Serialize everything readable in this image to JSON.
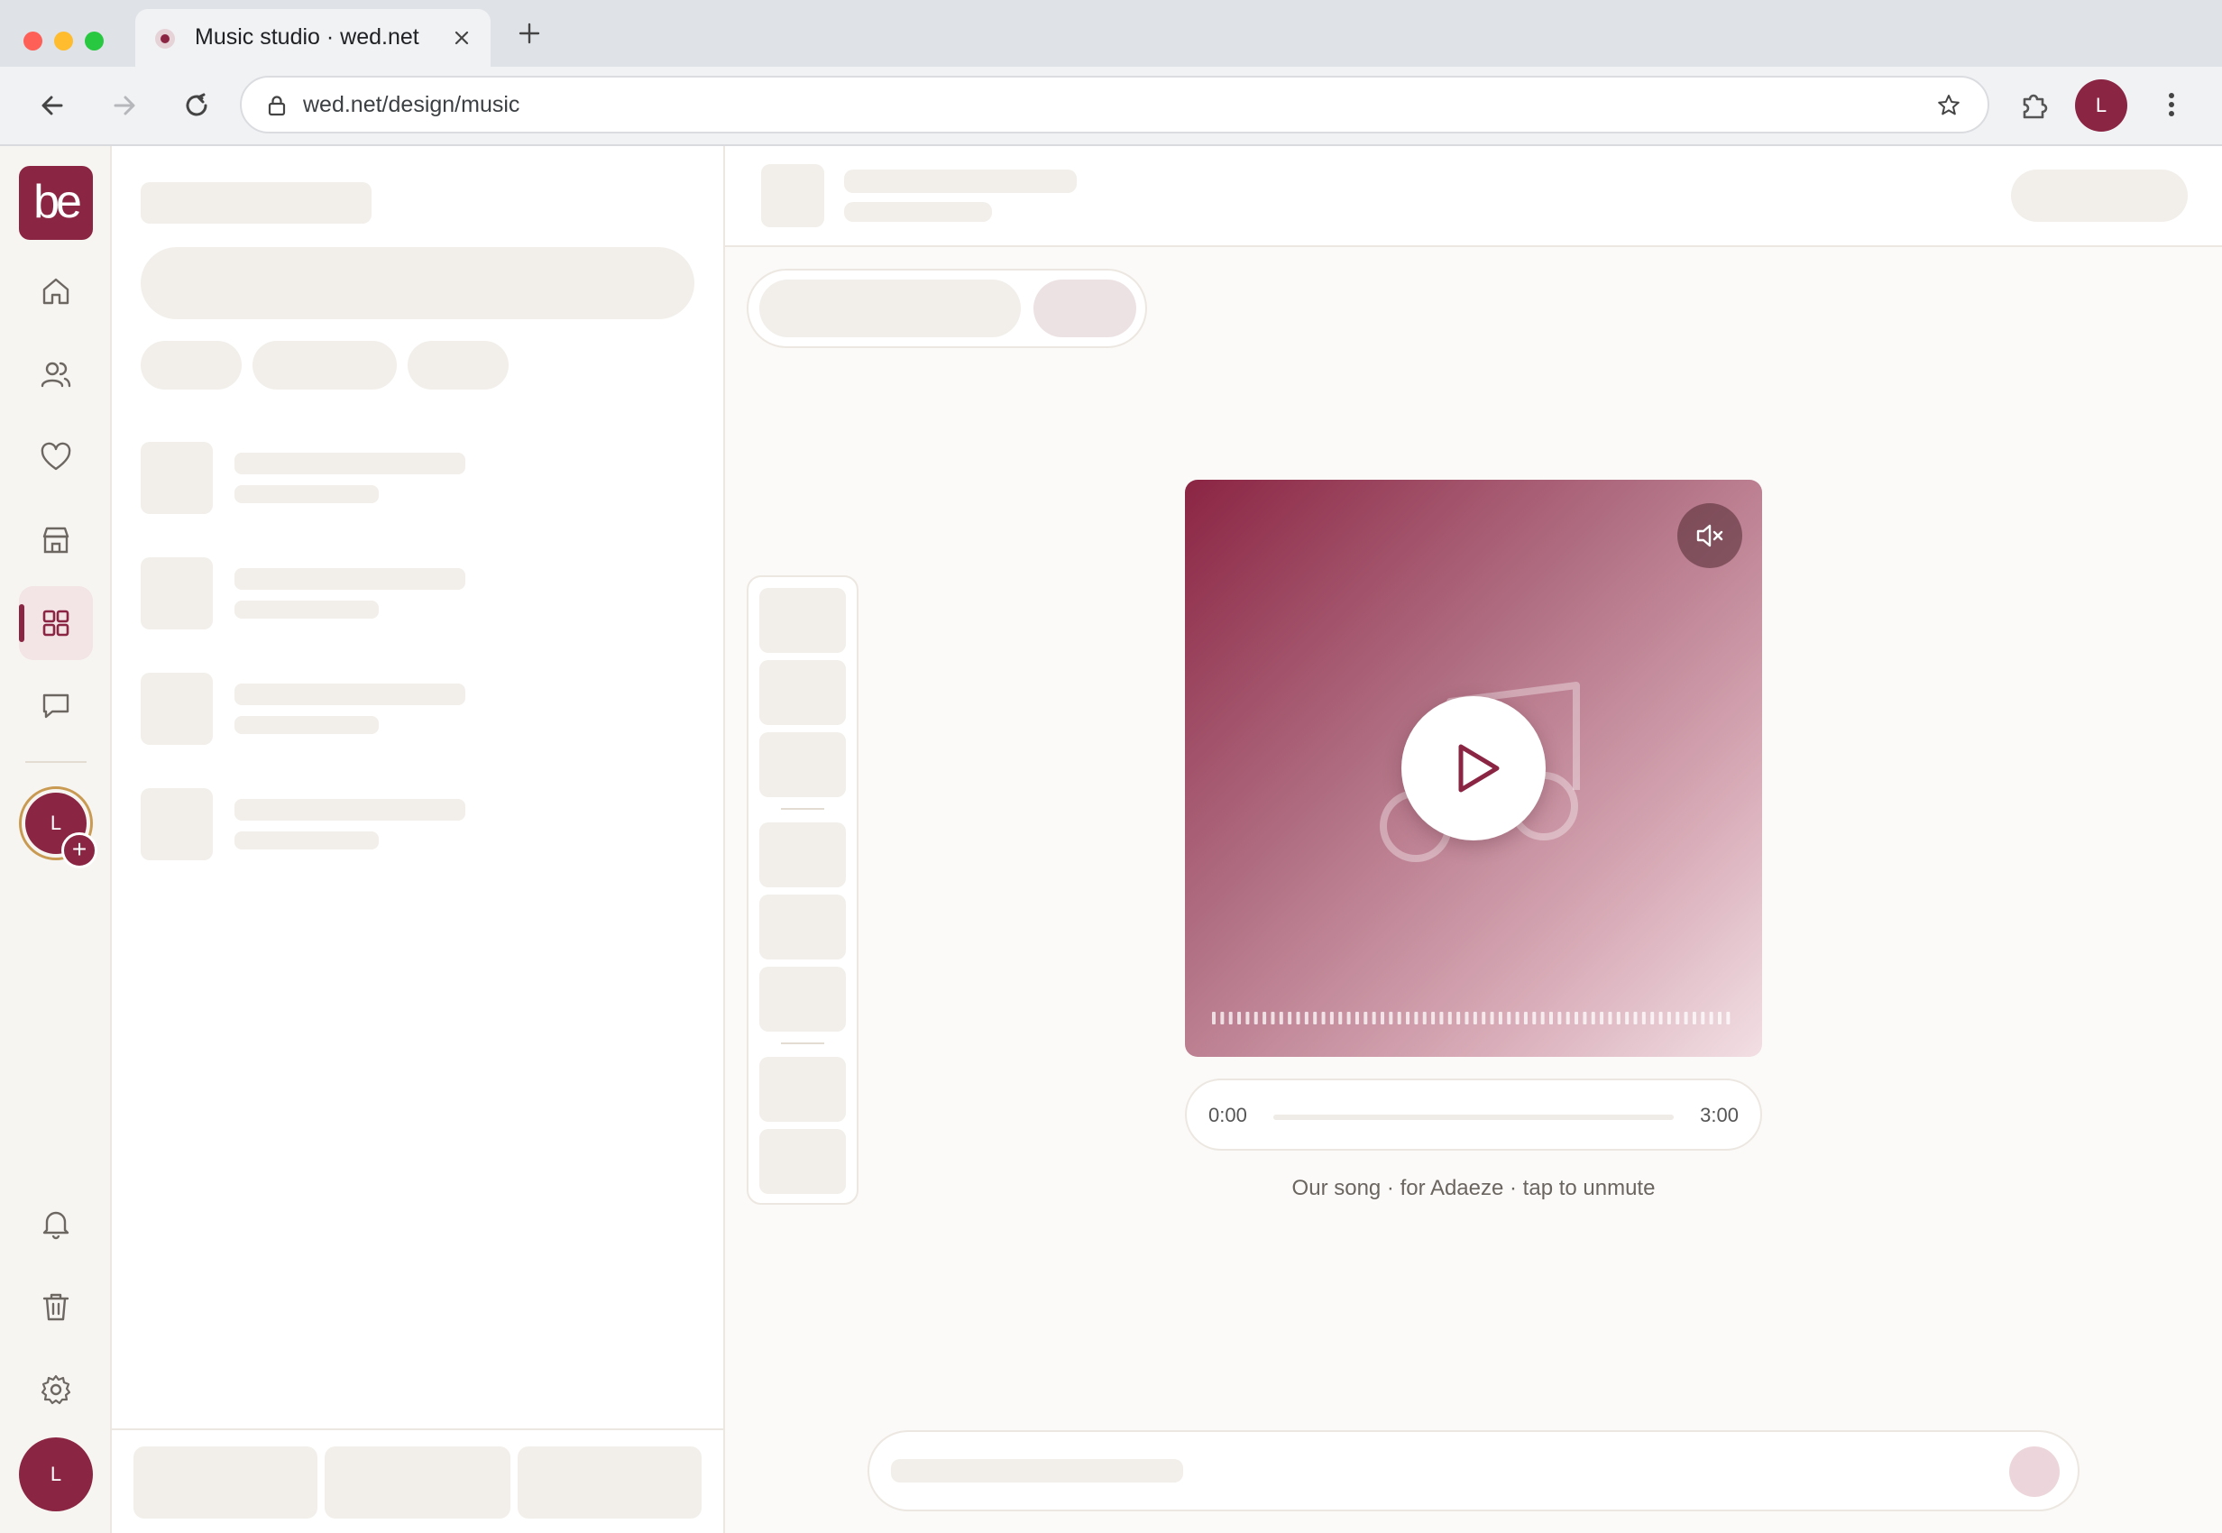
{
  "browser": {
    "tab_title": "Music studio · wed.net",
    "url": "wed.net/design/music",
    "profile_initial": "L"
  },
  "rail": {
    "logo": "be",
    "items": [
      {
        "name": "home",
        "icon": "home-icon"
      },
      {
        "name": "guests",
        "icon": "users-icon"
      },
      {
        "name": "favorites",
        "icon": "heart-icon"
      },
      {
        "name": "vendors",
        "icon": "store-icon"
      },
      {
        "name": "design",
        "icon": "grid-icon",
        "active": true
      },
      {
        "name": "messages",
        "icon": "chat-icon"
      }
    ],
    "workspace_initial": "L",
    "add_symbol": "+",
    "bottom_items": [
      {
        "name": "notifications",
        "icon": "bell-icon"
      },
      {
        "name": "trash",
        "icon": "trash-icon"
      },
      {
        "name": "settings",
        "icon": "gear-icon"
      }
    ],
    "user_initial": "L"
  },
  "player": {
    "current_time": "0:00",
    "duration": "3:00",
    "progress": 0,
    "caption": "Our song · for Adaeze · tap to unmute",
    "muted": true
  },
  "colors": {
    "brand": "#8b2544",
    "skeleton": "#f2efea"
  }
}
